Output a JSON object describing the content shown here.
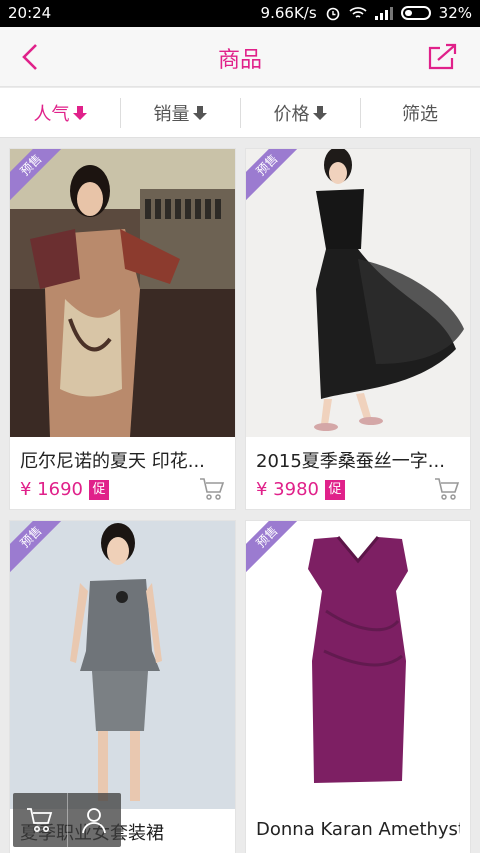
{
  "status": {
    "time": "20:24",
    "speed": "9.66K/s",
    "battery": "32%"
  },
  "nav": {
    "title": "商品"
  },
  "sort": {
    "popular": "人气",
    "sales": "销量",
    "price": "价格",
    "filter": "筛选"
  },
  "products": [
    {
      "badge": "预售",
      "name": "厄尔尼诺的夏天 印花...",
      "price": "¥ 1690",
      "promo": "促"
    },
    {
      "badge": "预售",
      "name": "2015夏季桑蚕丝一字...",
      "price": "¥ 3980",
      "promo": "促"
    },
    {
      "badge": "预售",
      "name": "夏季职业女套装裙"
    },
    {
      "badge": "预售",
      "name": "Donna Karan Amethyst..."
    }
  ],
  "colors": {
    "accent": "#e0218a",
    "ribbon": "#9b7bd0"
  }
}
